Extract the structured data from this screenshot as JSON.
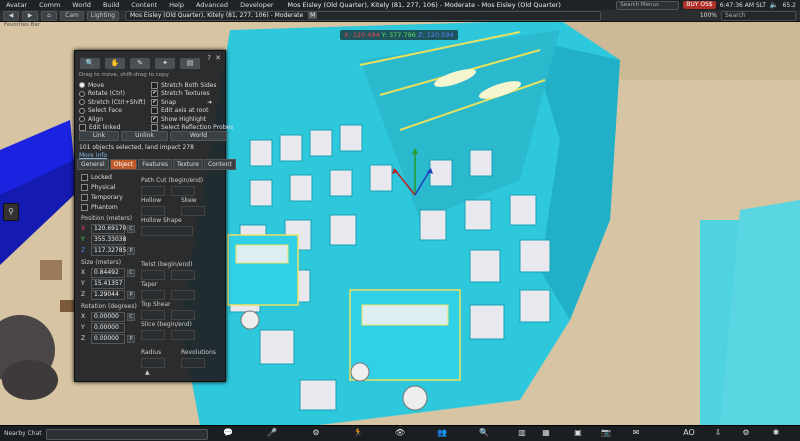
{
  "menu": {
    "items": [
      "Avatar",
      "Comm",
      "World",
      "Build",
      "Content",
      "Help",
      "Advanced",
      "Developer"
    ],
    "location": "Mos Eisley (Old Quarter), Kitely (81, 277, 106) - Moderate - Mos Eisley (Old Quarter)",
    "search_placeholder": "Search Menus",
    "buy_label": "BUY OS$",
    "time": "6:47:36 AM SLT",
    "fps": "65.2"
  },
  "nav": {
    "back_label": "Cam",
    "forward_label": "Lighting",
    "location_text": "Mos Eisley (Old Quarter), Kitely (81, 277, 106) - Moderate",
    "maturity_badge": "M",
    "zoom": "100%",
    "search_placeholder": "Search"
  },
  "favorites_label": "Favorites Bar",
  "coords": {
    "x": "X: 120.494",
    "y": "Y: 377.796",
    "z": "Z: 120.594"
  },
  "build": {
    "hint": "Drag to move, shift-drag to copy",
    "modes": [
      "Move",
      "Rotate (Ctrl)",
      "Stretch (Ctrl+Shift)",
      "Select Face",
      "Align",
      "Edit linked"
    ],
    "checks": [
      {
        "label": "Stretch Both Sides",
        "on": false
      },
      {
        "label": "Stretch Textures",
        "on": true
      },
      {
        "label": "Snap",
        "on": true
      },
      {
        "label": "Edit axis at root",
        "on": false
      },
      {
        "label": "Show Highlight",
        "on": true
      },
      {
        "label": "Select Reflection Probes",
        "on": false
      }
    ],
    "buttons": {
      "link": "Link",
      "unlink": "Unlink",
      "world": "World"
    },
    "selection_info": "101 objects selected, land impact 278",
    "more_info": "More info",
    "tabs": [
      "General",
      "Object",
      "Features",
      "Texture",
      "Content"
    ],
    "object": {
      "locked": "Locked",
      "physical": "Physical",
      "temporary": "Temporary",
      "phantom": "Phantom",
      "position_label": "Position (meters)",
      "pos": [
        "120.69170",
        "355.33038",
        "117.32785"
      ],
      "size_label": "Size (meters)",
      "size": [
        "0.84492",
        "15.41357",
        "1.29044"
      ],
      "rotation_label": "Rotation (degrees)",
      "rot": [
        "0.00000",
        "0.00000",
        "0.00000"
      ],
      "path_cut": "Path Cut (begin/end)",
      "hollow": "Hollow",
      "skew": "Skew",
      "hollow_shape": "Hollow Shape",
      "twist": "Twist (begin/end)",
      "taper": "Taper",
      "top_shear": "Top Shear",
      "slice": "Slice (begin/end)",
      "radius": "Radius",
      "revolutions": "Revolutions"
    }
  },
  "bottom": {
    "nearby_chat": "Nearby Chat",
    "ao": "AO"
  }
}
